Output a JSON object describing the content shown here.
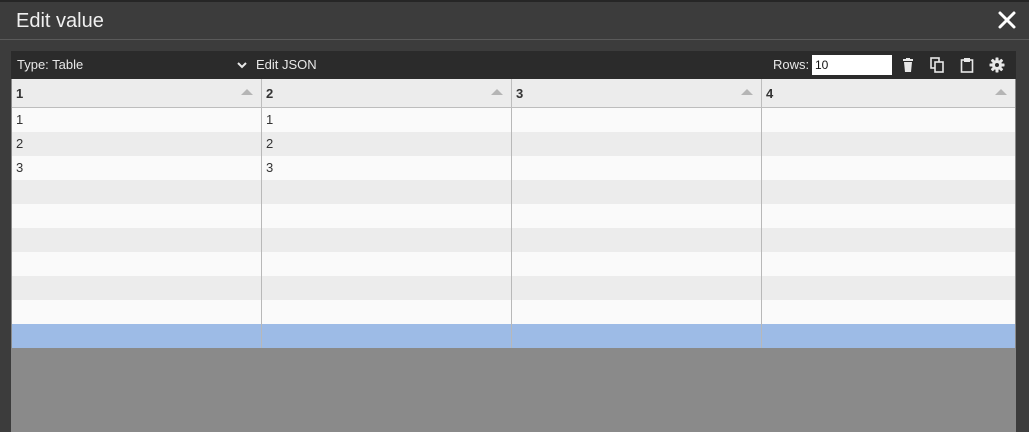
{
  "dialog": {
    "title": "Edit value"
  },
  "toolbar": {
    "type_label": "Type: Table",
    "edit_json_label": "Edit JSON",
    "rows_label": "Rows:",
    "rows_value": "10",
    "icons": [
      "trash-icon",
      "copy-icon",
      "clipboard-icon",
      "gear-icon"
    ]
  },
  "table": {
    "columns": [
      "1",
      "2",
      "3",
      "4"
    ],
    "rows": [
      [
        "1",
        "1",
        "",
        ""
      ],
      [
        "2",
        "2",
        "",
        ""
      ],
      [
        "3",
        "3",
        "",
        ""
      ],
      [
        "",
        "",
        "",
        ""
      ],
      [
        "",
        "",
        "",
        ""
      ],
      [
        "",
        "",
        "",
        ""
      ],
      [
        "",
        "",
        "",
        ""
      ],
      [
        "",
        "",
        "",
        ""
      ],
      [
        "",
        "",
        "",
        ""
      ],
      [
        "",
        "",
        "",
        ""
      ]
    ],
    "selected_row": 9
  },
  "colors": {
    "toolbar_bg": "#2b2b2b",
    "selection": "#9dbbe6",
    "dialog_bg": "#3c3c3c"
  }
}
